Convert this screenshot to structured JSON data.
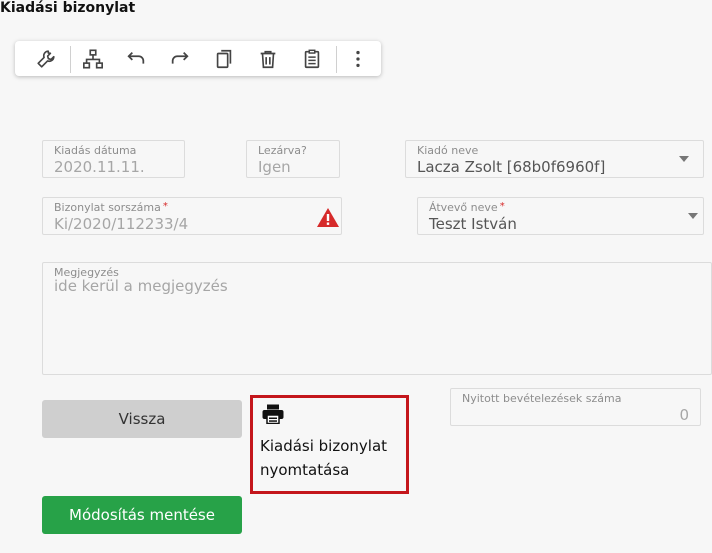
{
  "page": {
    "title": "Kiadási bizonylat"
  },
  "toolbar": {
    "icons": [
      "wrench-icon",
      "hierarchy-icon",
      "undo-icon",
      "redo-icon",
      "copy-icon",
      "trash-icon",
      "clipboard-icon",
      "more-vert-icon"
    ]
  },
  "form": {
    "issue_date": {
      "label": "Kiadás dátuma",
      "value": "2020.11.11."
    },
    "closed": {
      "label": "Lezárva?",
      "value": "Igen"
    },
    "issuer": {
      "label": "Kiadó neve",
      "value": "Lacza Zsolt [68b0f6960f]"
    },
    "doc_number": {
      "label": "Bizonylat sorszáma",
      "required_mark": "*",
      "value": "Ki/2020/112233/4"
    },
    "receiver": {
      "label": "Átvevő neve",
      "required_mark": "*",
      "value": "Teszt István"
    },
    "note": {
      "label": "Megjegyzés",
      "placeholder": "ide kerül a megjegyzés"
    },
    "open_receipts": {
      "label": "Nyitott bevételezések száma",
      "value": "0"
    }
  },
  "actions": {
    "back_label": "Vissza",
    "print_label": "Kiadási bizonylat nyomtatása",
    "save_label": "Módosítás mentése"
  },
  "colors": {
    "save": "#27a248",
    "highlight": "#c4161c",
    "warning": "#d62a2a"
  }
}
